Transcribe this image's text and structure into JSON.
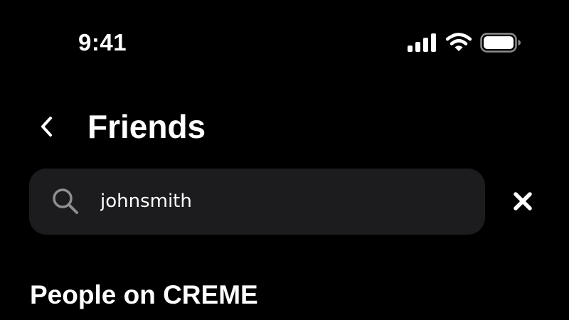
{
  "status_bar": {
    "time": "9:41"
  },
  "header": {
    "title": "Friends",
    "back_icon": "chevron-left-icon"
  },
  "search": {
    "value": "johnsmith",
    "placeholder": "",
    "icon": "search-icon",
    "clear_icon": "close-icon"
  },
  "section": {
    "title": "People on CREME"
  },
  "colors": {
    "background": "#000000",
    "search_field": "#1c1c1e",
    "text": "#ffffff",
    "icon_muted": "#8e8e93"
  }
}
